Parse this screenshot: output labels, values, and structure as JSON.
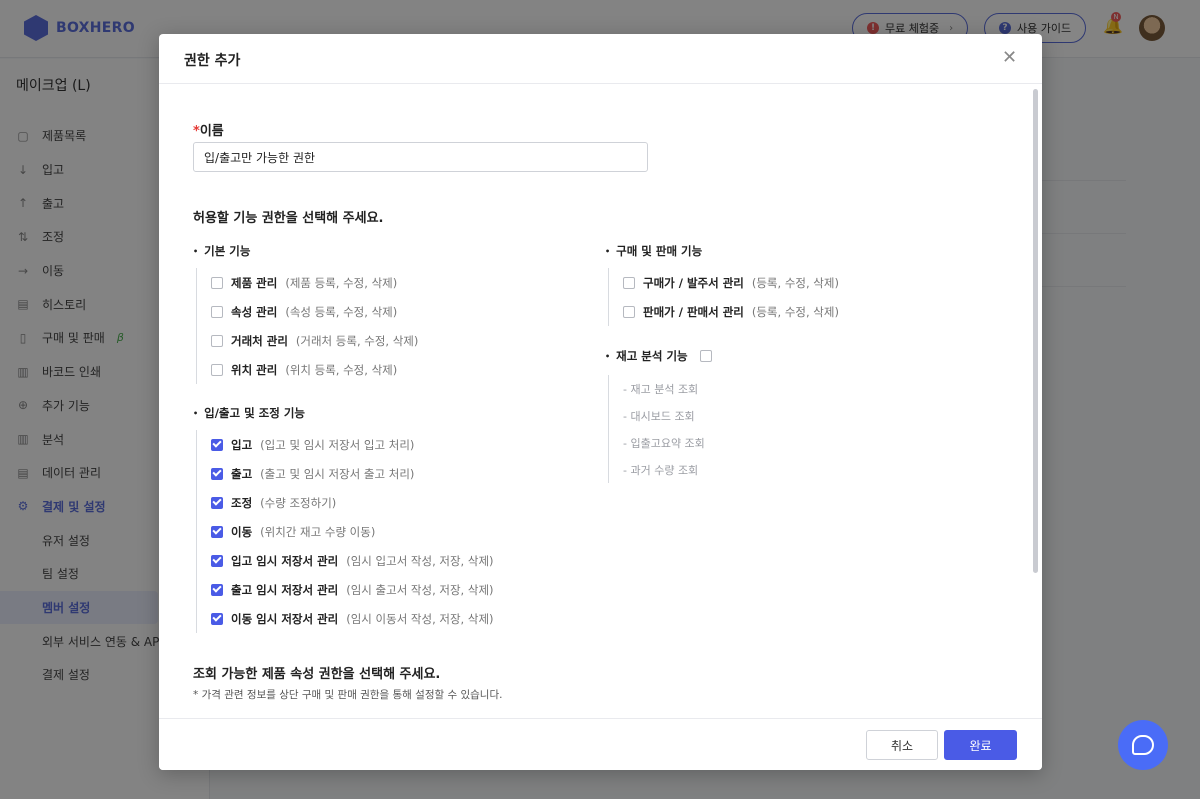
{
  "app": {
    "logo_text": "BOXHERO",
    "trial_label": "무료 체험중",
    "guide_label": "사용 가이드",
    "bell_badge": "N",
    "brand_color": "#5b6ddb"
  },
  "sidebar": {
    "workspace": "메이크업 (L)",
    "items": [
      {
        "label": "제품목록",
        "icon": "box-icon"
      },
      {
        "label": "입고",
        "icon": "arrow-down-icon"
      },
      {
        "label": "출고",
        "icon": "arrow-up-icon"
      },
      {
        "label": "조정",
        "icon": "swap-icon"
      },
      {
        "label": "이동",
        "icon": "arrow-right-icon"
      },
      {
        "label": "히스토리",
        "icon": "history-icon"
      },
      {
        "label": "구매 및 판매",
        "icon": "document-icon",
        "beta": "β"
      },
      {
        "label": "바코드 인쇄",
        "icon": "barcode-icon"
      },
      {
        "label": "추가 기능",
        "icon": "plus-circle-icon"
      },
      {
        "label": "분석",
        "icon": "chart-icon"
      },
      {
        "label": "데이터 관리",
        "icon": "database-icon"
      },
      {
        "label": "결제 및 설정",
        "icon": "gear-icon"
      }
    ],
    "sub_items": [
      {
        "label": "유저 설정"
      },
      {
        "label": "팀 설정"
      },
      {
        "label": "멤버 설정"
      },
      {
        "label": "외부 서비스 연동 & API"
      },
      {
        "label": "결제 설정"
      }
    ]
  },
  "modal": {
    "title": "권한 추가",
    "name_label": "이름",
    "name_required": "*",
    "name_value": "입/출고만 가능한 권한",
    "section_title": "허용할 기능 권한을 선택해 주세요.",
    "basic": {
      "title": "기본 기능",
      "items": [
        {
          "label": "제품 관리",
          "desc": "(제품 등록, 수정, 삭제)",
          "checked": false
        },
        {
          "label": "속성 관리",
          "desc": "(속성 등록, 수정, 삭제)",
          "checked": false
        },
        {
          "label": "거래처 관리",
          "desc": "(거래처 등록, 수정, 삭제)",
          "checked": false
        },
        {
          "label": "위치 관리",
          "desc": "(위치 등록, 수정, 삭제)",
          "checked": false
        }
      ]
    },
    "inout": {
      "title": "입/출고 및 조정 기능",
      "items": [
        {
          "label": "입고",
          "desc": "(입고 및 임시 저장서 입고 처리)",
          "checked": true
        },
        {
          "label": "출고",
          "desc": "(출고 및 임시 저장서 출고 처리)",
          "checked": true
        },
        {
          "label": "조정",
          "desc": "(수량 조정하기)",
          "checked": true
        },
        {
          "label": "이동",
          "desc": "(위치간 재고 수량 이동)",
          "checked": true
        },
        {
          "label": "입고 임시 저장서 관리",
          "desc": "(임시 입고서 작성, 저장, 삭제)",
          "checked": true
        },
        {
          "label": "출고 임시 저장서 관리",
          "desc": "(임시 출고서 작성, 저장, 삭제)",
          "checked": true
        },
        {
          "label": "이동 임시 저장서 관리",
          "desc": "(임시 이동서 작성, 저장, 삭제)",
          "checked": true
        }
      ]
    },
    "purchase": {
      "title": "구매 및 판매 기능",
      "items": [
        {
          "label": "구매가 / 발주서 관리",
          "desc": "(등록, 수정, 삭제)",
          "checked": false
        },
        {
          "label": "판매가 / 판매서 관리",
          "desc": "(등록, 수정, 삭제)",
          "checked": false
        }
      ]
    },
    "analysis": {
      "title": "재고 분석 기능",
      "checked": false,
      "items": [
        "- 재고 분석 조회",
        "- 대시보드 조회",
        "- 입출고요약 조회",
        "- 과거 수량 조회"
      ]
    },
    "attr_section_title": "조회 가능한 제품 속성 권한을 선택해 주세요.",
    "attr_note": "* 가격 관련 정보를 상단 구매 및 판매 권한을 통해 설정할 수 있습니다.",
    "cancel_label": "취소",
    "done_label": "완료",
    "accent_color": "#4a5be6"
  }
}
